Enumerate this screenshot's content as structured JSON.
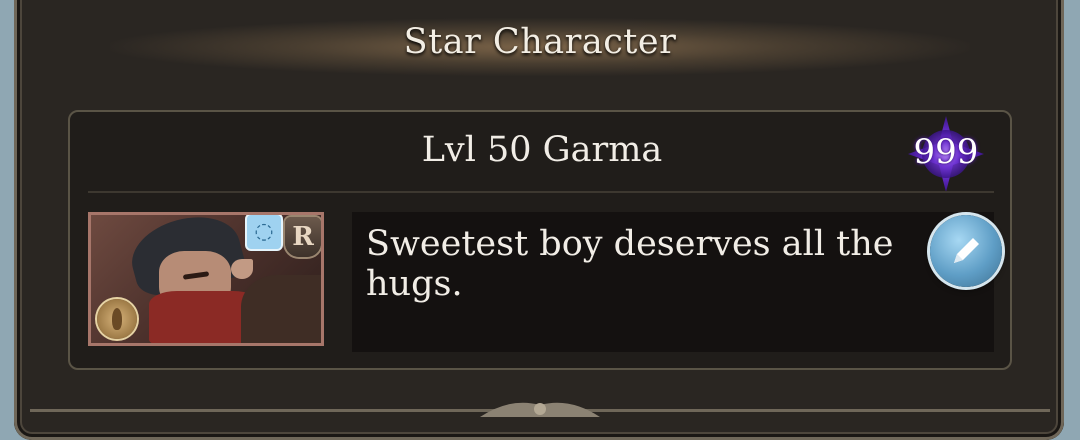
{
  "panel": {
    "title": "Star Character"
  },
  "character": {
    "name_line": "Lvl 50 Garma",
    "star_count": "999",
    "rarity_letter": "R",
    "comment": "Sweetest boy deserves all the hugs."
  },
  "icons": {
    "element": "earth-element-icon",
    "ring": "ring-icon",
    "rarity": "rarity-r-icon",
    "edit": "pencil-edit-icon",
    "star_badge": "purple-star-icon"
  },
  "colors": {
    "star_badge": "#5b22b0",
    "edit_button": "#5f9ec6",
    "panel_bg": "#221f1c"
  }
}
